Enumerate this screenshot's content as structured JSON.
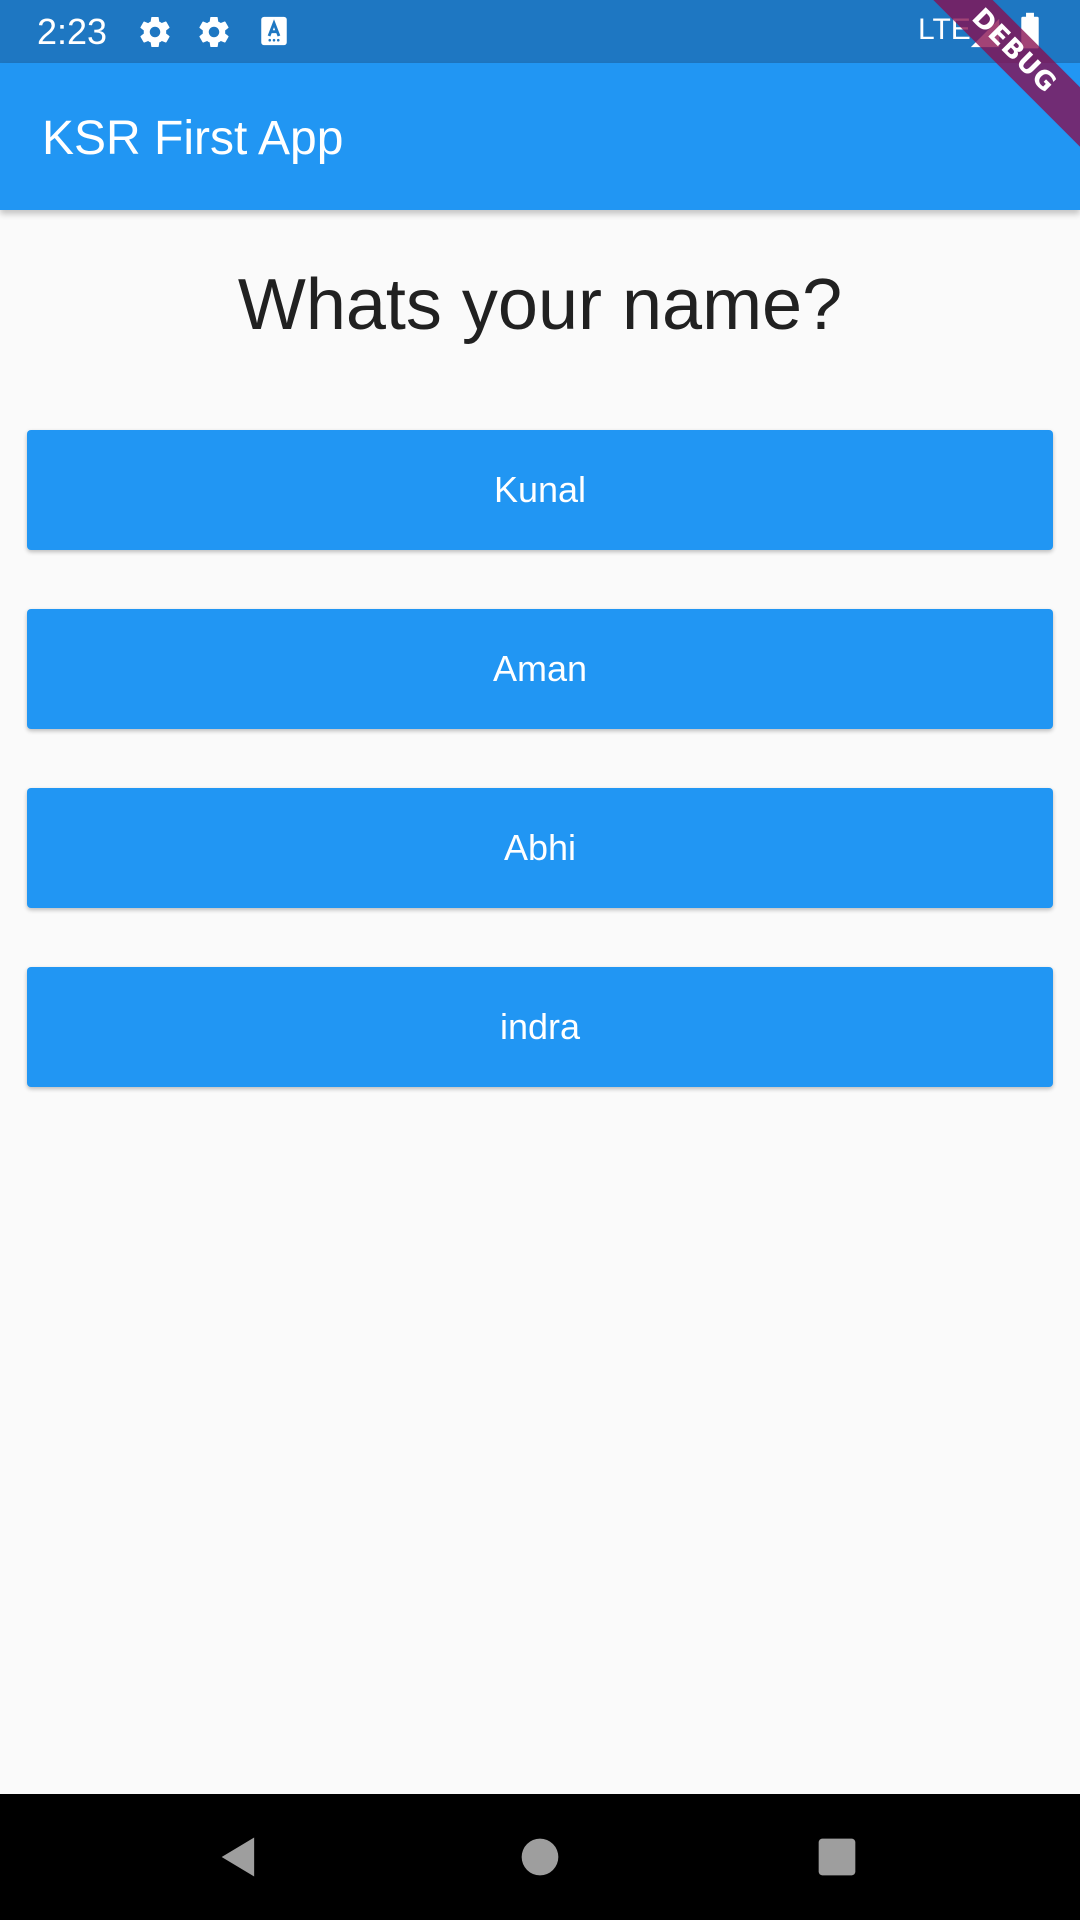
{
  "status_bar": {
    "time": "2:23",
    "network": "LTE",
    "icons": [
      "settings-icon",
      "settings-icon",
      "keyboard-a-icon",
      "signal-icon",
      "battery-icon"
    ],
    "background_color": "#1e77c2"
  },
  "app_bar": {
    "title": "KSR First App",
    "background_color": "#2196f3"
  },
  "debug_banner": {
    "label": "DEBUG"
  },
  "main": {
    "question": "Whats your name?",
    "answers": [
      {
        "label": "Kunal"
      },
      {
        "label": "Aman"
      },
      {
        "label": "Abhi"
      },
      {
        "label": "indra"
      }
    ],
    "button_color": "#2196f3"
  },
  "nav_bar": {
    "icons": [
      "back-icon",
      "home-icon",
      "recents-icon"
    ]
  }
}
